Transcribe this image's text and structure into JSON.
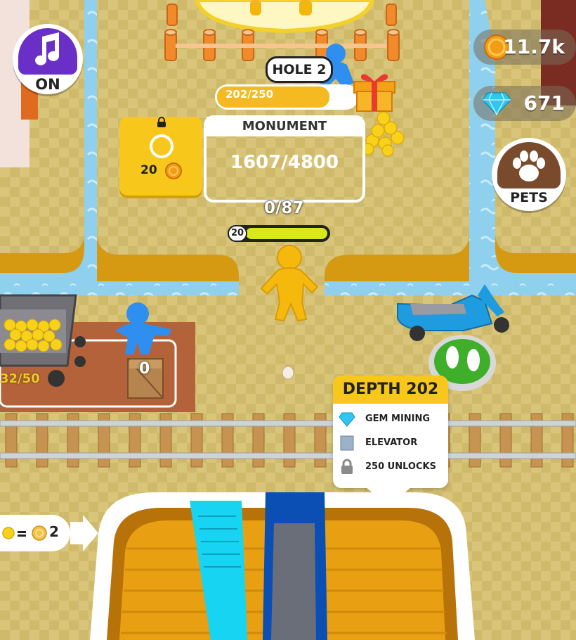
{
  "hud": {
    "music_button": {
      "icon": "music-note-icon",
      "label": "ON"
    },
    "coins": {
      "icon": "coin-icon",
      "value": "11.7k"
    },
    "gems": {
      "icon": "diamond-icon",
      "value": "671"
    },
    "pets_button": {
      "icon": "paw-icon",
      "label": "PETS"
    }
  },
  "hole": {
    "tag": "HOLE 2",
    "progress_text": "202/250",
    "progress_fraction": 0.808,
    "reward_icon": "gift-icon"
  },
  "monument": {
    "title": "MONUMENT",
    "progress": "1607/4800"
  },
  "locked_slot": {
    "icon": "lock-icon",
    "cost": "20"
  },
  "player": {
    "carry_count": "0/87",
    "level": "20",
    "level_fill_fraction": 1.0
  },
  "mine_cart": {
    "count": "32/50"
  },
  "crate": {
    "count": "0"
  },
  "depth_card": {
    "title": "DEPTH 202",
    "items": [
      {
        "icon": "diamond-icon",
        "label": "GEM MINING"
      },
      {
        "icon": "elevator-icon",
        "label": "ELEVATOR"
      },
      {
        "icon": "lock-icon",
        "label": "250 UNLOCKS"
      }
    ]
  },
  "exchange": {
    "rate": "2"
  },
  "colors": {
    "ground": "#d9c57a",
    "water": "#8fd0ef",
    "accent_yellow": "#f7c81b",
    "music_purple": "#6a2fc7",
    "pets_brown": "#7a4a2c",
    "player_blue": "#2f8ff0",
    "player_yellow": "#f5b90e",
    "level_green": "#d8e81c",
    "step_pad_green": "#3fae2a"
  }
}
